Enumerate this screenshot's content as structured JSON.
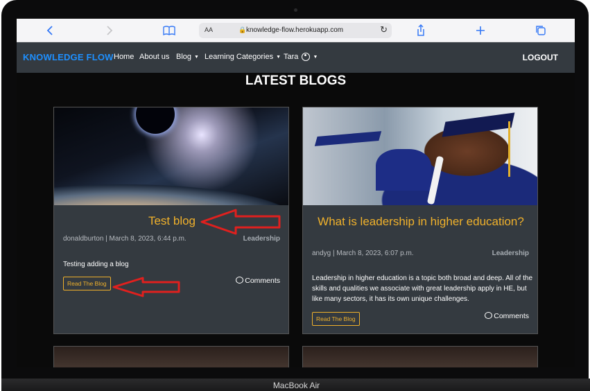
{
  "device_label": "MacBook Air",
  "browser": {
    "back_icon": "chevron-left",
    "forward_icon": "chevron-right",
    "reader_icon": "book",
    "text_size": "AA",
    "url": "knowledge-flow.herokuapp.com",
    "reload_icon": "reload",
    "share_icon": "share",
    "new_tab_icon": "plus",
    "tabs_icon": "tabs"
  },
  "navbar": {
    "brand": "KNOWLEDGE FLOW",
    "items": [
      {
        "label": "Home"
      },
      {
        "label": "About us"
      },
      {
        "label": "Blog"
      },
      {
        "label": "Learning Categories"
      },
      {
        "label": "Tara"
      }
    ],
    "logout": "LOGOUT"
  },
  "page": {
    "heading": "LATEST BLOGS"
  },
  "blogs": [
    {
      "title": "Test blog",
      "meta": "donaldburton | March 8, 2023, 6:44 p.m.",
      "category": "Leadership",
      "excerpt": "Testing adding a blog",
      "read_label": "Read The Blog",
      "comments_label": "Comments"
    },
    {
      "title": "What is leadership in higher education?",
      "meta": "andyg | March 8, 2023, 6:07 p.m.",
      "category": "Leadership",
      "excerpt": "Leadership in higher education is a topic both broad and deep. All of the skills and qualities we associate with great leadership apply in HE, but like many sectors, it has its own unique challenges.",
      "read_label": "Read The Blog",
      "comments_label": "Comments"
    }
  ],
  "colors": {
    "accent": "#f0b12b",
    "brand": "#1e90ff",
    "navbar": "#343a40",
    "annotation_arrow": "#e0201e"
  }
}
